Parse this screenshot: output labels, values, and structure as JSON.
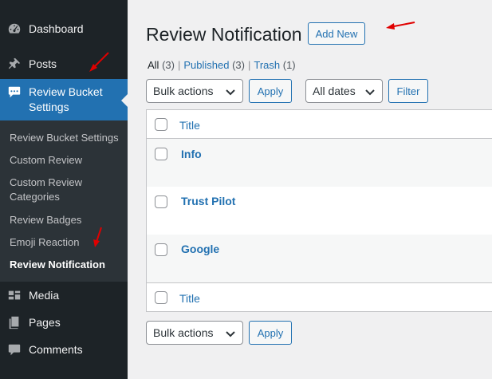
{
  "sidebar": {
    "items": [
      {
        "label": "Dashboard",
        "icon": "dashboard-icon"
      },
      {
        "label": "Posts",
        "icon": "pin-icon"
      },
      {
        "label": "Review Bucket Settings",
        "icon": "speech-bubble-icon"
      },
      {
        "label": "Media",
        "icon": "media-icon"
      },
      {
        "label": "Pages",
        "icon": "pages-icon"
      },
      {
        "label": "Comments",
        "icon": "comments-icon"
      }
    ],
    "active_line1": "Review Bucket",
    "active_line2": "Settings",
    "submenu": [
      "Review Bucket Settings",
      "Custom Review",
      "Custom Review Categories",
      "Review Badges",
      "Emoji Reaction",
      "Review Notification"
    ],
    "current_submenu": "Review Notification"
  },
  "header": {
    "title": "Review Notification",
    "add_new": "Add New"
  },
  "filters": {
    "views": [
      {
        "label": "All",
        "count": "(3)"
      },
      {
        "label": "Published",
        "count": "(3)"
      },
      {
        "label": "Trash",
        "count": "(1)"
      }
    ],
    "separator": "|",
    "bulk_actions": "Bulk actions",
    "apply": "Apply",
    "dates": "All dates",
    "filter": "Filter"
  },
  "table": {
    "column_title": "Title",
    "rows": [
      "Info",
      "Trust Pilot",
      "Google"
    ]
  },
  "bottom": {
    "bulk_actions": "Bulk actions",
    "apply": "Apply"
  },
  "colors": {
    "sidebar_bg": "#1d2327",
    "submenu_bg": "#2c3338",
    "accent": "#2271b1",
    "annotation": "#e00000"
  }
}
